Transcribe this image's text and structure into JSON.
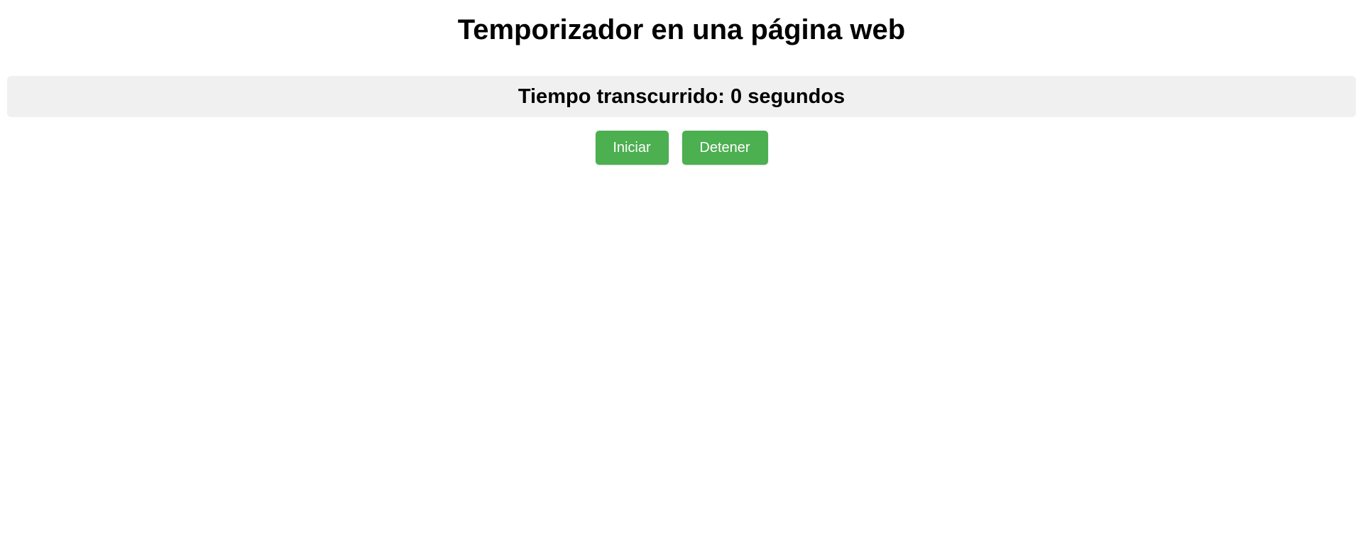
{
  "page": {
    "title": "Temporizador en una página web"
  },
  "timer": {
    "label": "Tiempo transcurrido:",
    "value": "0",
    "unit": "segundos"
  },
  "controls": {
    "start_label": "Iniciar",
    "stop_label": "Detener"
  },
  "colors": {
    "button_bg": "#4caf50",
    "timer_bg": "#f0f0f0"
  }
}
